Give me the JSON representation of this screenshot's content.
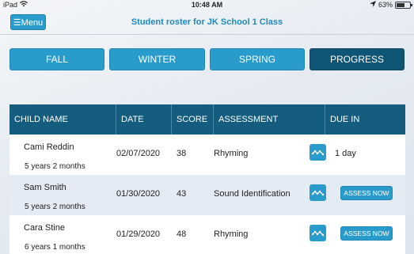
{
  "status_bar": {
    "device": "iPad",
    "time": "10:48 AM",
    "battery": "63%",
    "battery_level": 0.63
  },
  "header": {
    "menu_label": "☰Menu",
    "title": "Student roster for JK School 1 Class"
  },
  "tabs": [
    {
      "label": "FALL",
      "active": false
    },
    {
      "label": "WINTER",
      "active": false
    },
    {
      "label": "SPRING",
      "active": false
    },
    {
      "label": "PROGRESS",
      "active": true
    }
  ],
  "table": {
    "headers": [
      "CHILD NAME",
      "DATE",
      "SCORE",
      "ASSESSMENT",
      "DUE IN"
    ],
    "rows": [
      {
        "name": "Cami Reddin",
        "age": "5 years 2 months",
        "date": "02/07/2020",
        "score": "38",
        "assessment": "Rhyming",
        "chart_icon": "trend-chart-icon",
        "due": "1 day",
        "action": ""
      },
      {
        "name": "Sam Smith",
        "age": "5 years 2 months",
        "date": "01/30/2020",
        "score": "43",
        "assessment": "Sound Identification",
        "chart_icon": "trend-chart-icon",
        "due": "",
        "action": "ASSESS NOW"
      },
      {
        "name": "Cara Stine",
        "age": "6 years 1 months",
        "date": "01/29/2020",
        "score": "48",
        "assessment": "Rhyming",
        "chart_icon": "trend-chart-icon",
        "due": "",
        "action": "ASSESS NOW"
      }
    ]
  },
  "colors": {
    "accent": "#2a9ccc",
    "active_tab": "#0f5576",
    "table_header": "#155d7f",
    "title": "#1e8ac0"
  }
}
